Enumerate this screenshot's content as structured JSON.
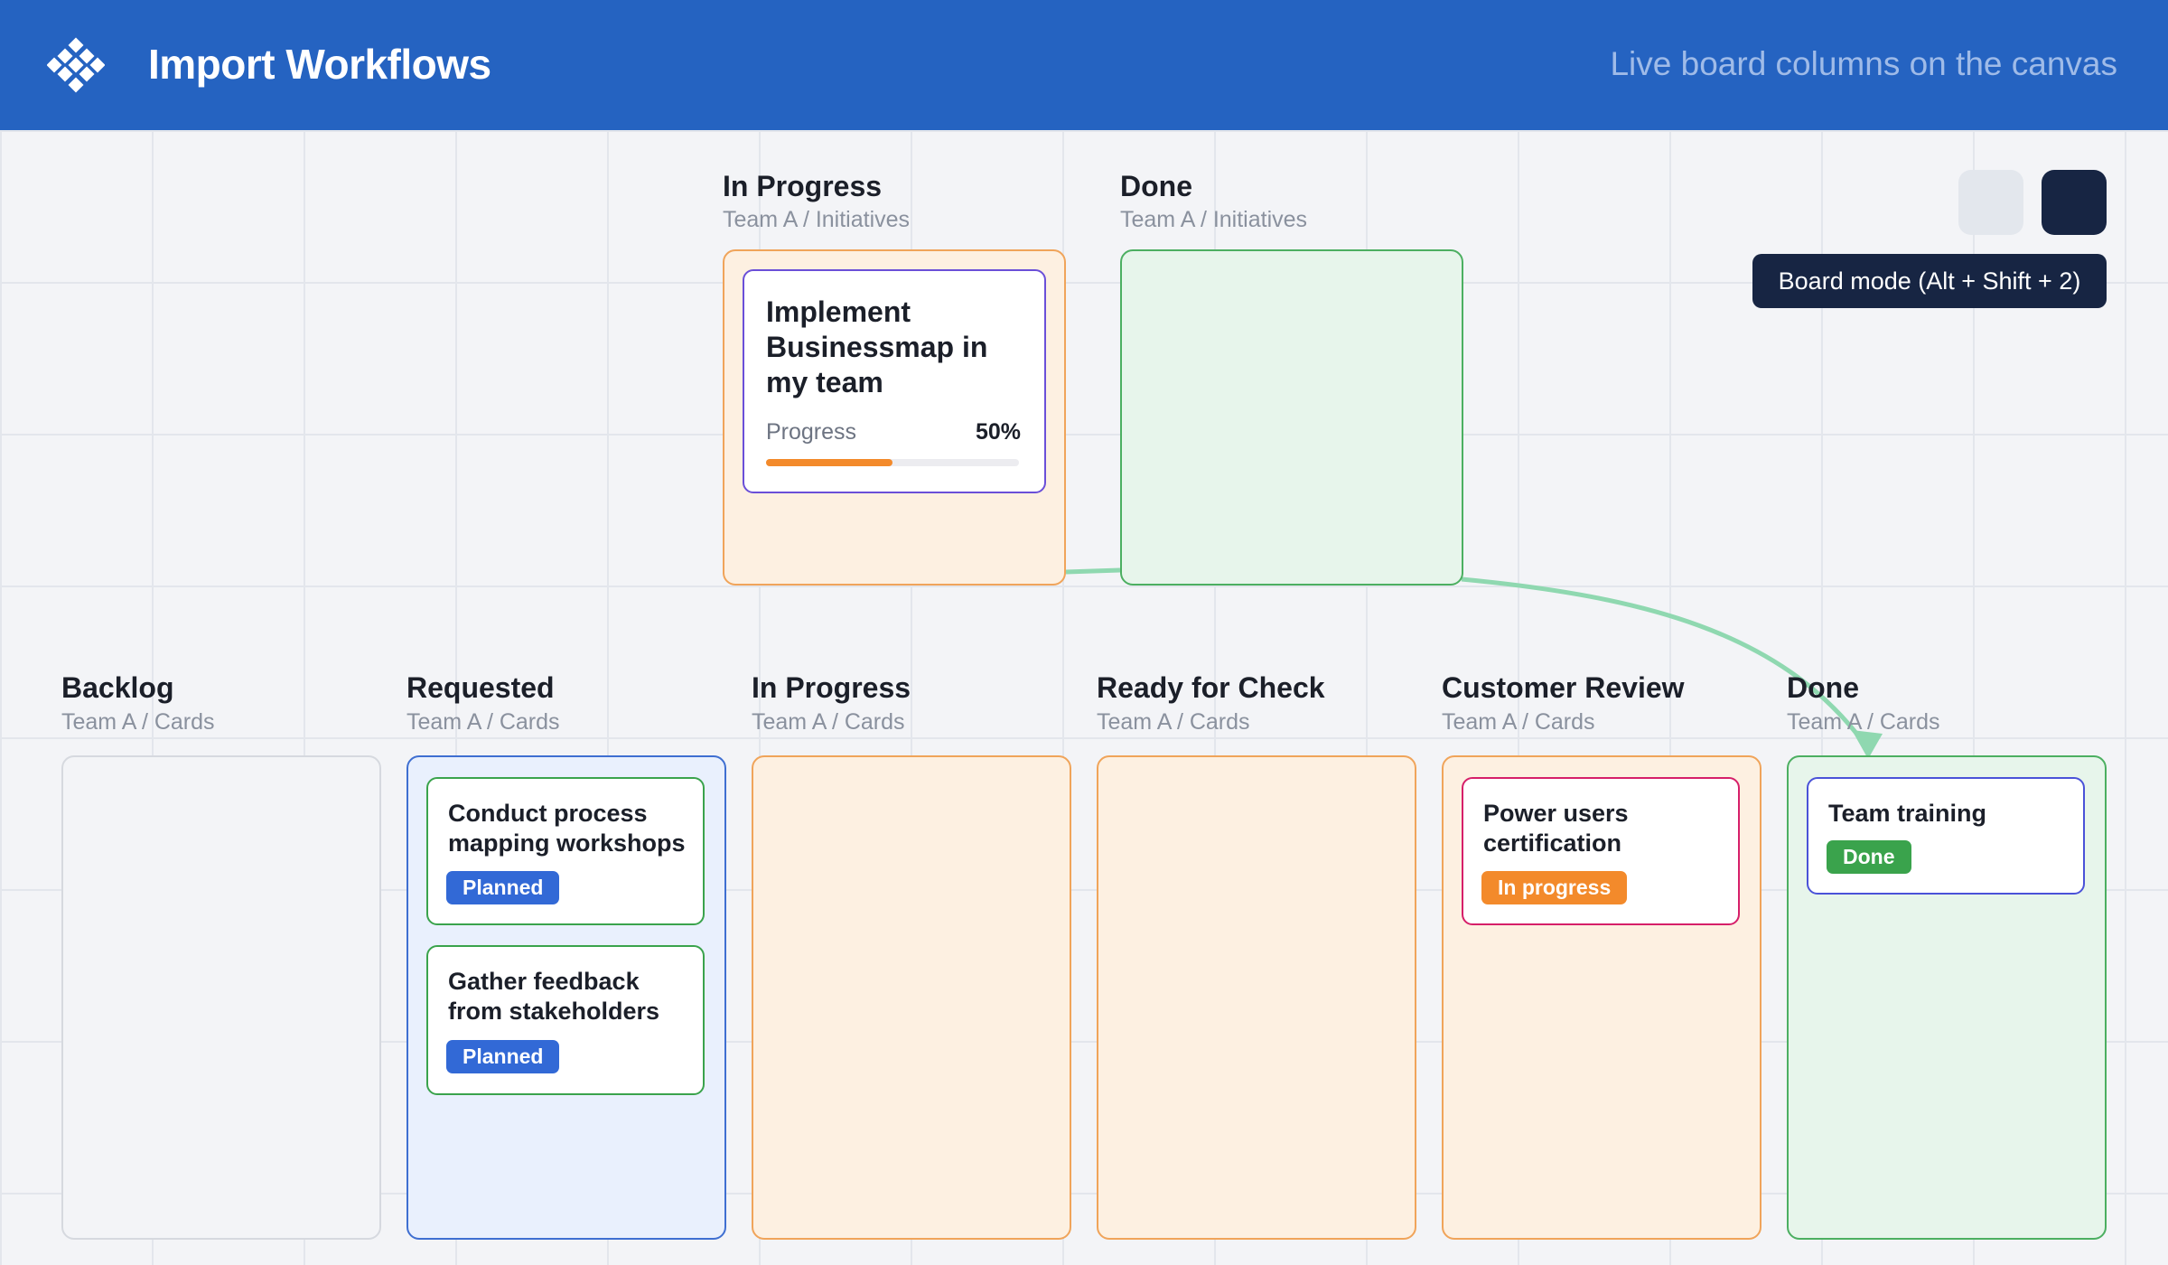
{
  "header": {
    "title": "Import Workflows",
    "subtitle": "Live board columns on the canvas",
    "logo_icon": "diamond-grid-logo-icon"
  },
  "toolbar": {
    "tooltip": "Board mode (Alt + Shift + 2)"
  },
  "initiatives": [
    {
      "title": "In Progress",
      "path": "Team A / Initiatives",
      "cards": [
        {
          "title": "Implement Businessmap in my team",
          "progress_label": "Progress",
          "progress_text": "50%",
          "progress": 0.5
        }
      ]
    },
    {
      "title": "Done",
      "path": "Team A / Initiatives",
      "cards": []
    }
  ],
  "columns": [
    {
      "title": "Backlog",
      "path": "Team A / Cards",
      "cards": []
    },
    {
      "title": "Requested",
      "path": "Team A / Cards",
      "cards": [
        {
          "title": "Conduct process mapping workshops",
          "badge": "Planned"
        },
        {
          "title": "Gather feedback from stakeholders",
          "badge": "Planned"
        }
      ]
    },
    {
      "title": "In Progress",
      "path": "Team A / Cards",
      "cards": []
    },
    {
      "title": "Ready for Check",
      "path": "Team A / Cards",
      "cards": []
    },
    {
      "title": "Customer Review",
      "path": "Team A / Cards",
      "cards": [
        {
          "title": "Power users certification",
          "badge": "In progress"
        }
      ]
    },
    {
      "title": "Done",
      "path": "Team A / Cards",
      "cards": [
        {
          "title": "Team training",
          "badge": "Done"
        }
      ]
    }
  ],
  "colors": {
    "header": "#2563c1",
    "orange_column": "#fdf0e1",
    "green_column": "#e7f5eb",
    "blue_column": "#e9f0fd",
    "connector": "#8fd8b0",
    "tooltip": "#172543"
  }
}
